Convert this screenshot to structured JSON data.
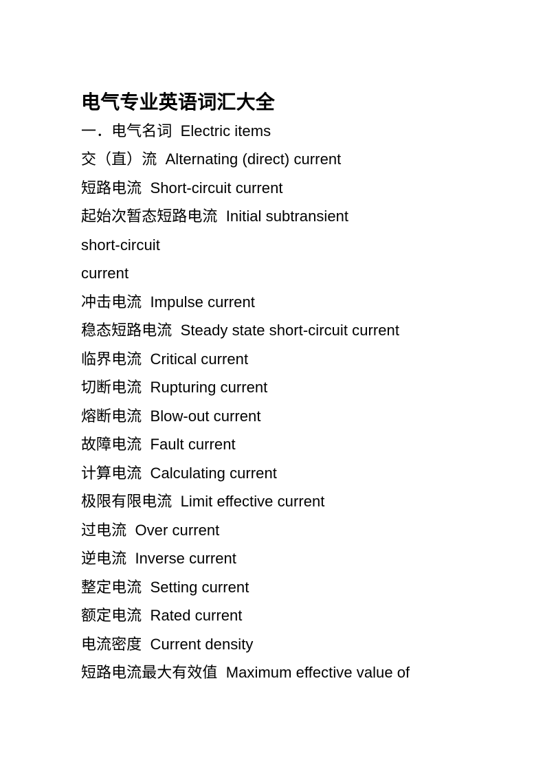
{
  "document": {
    "title": "电气专业英语词汇大全",
    "section_heading": "一．电气名词  Electric items",
    "lines": [
      {
        "text": "一．电气名词  Electric items",
        "kind": "section-heading"
      },
      {
        "text": "交（直）流  Alternating (direct) current",
        "kind": "entry"
      },
      {
        "text": "短路电流  Short-circuit current",
        "kind": "entry"
      },
      {
        "text": "起始次暂态短路电流  Initial subtransient",
        "kind": "entry"
      },
      {
        "text": "short-circuit",
        "kind": "continuation"
      },
      {
        "text": "current",
        "kind": "continuation"
      },
      {
        "text": "冲击电流  Impulse current",
        "kind": "entry"
      },
      {
        "text": "稳态短路电流  Steady state short-circuit current",
        "kind": "entry"
      },
      {
        "text": "临界电流  Critical current",
        "kind": "entry"
      },
      {
        "text": "切断电流  Rupturing current",
        "kind": "entry"
      },
      {
        "text": "熔断电流  Blow-out current",
        "kind": "entry"
      },
      {
        "text": "故障电流  Fault current",
        "kind": "entry"
      },
      {
        "text": "计算电流  Calculating current",
        "kind": "entry"
      },
      {
        "text": "极限有限电流  Limit effective current",
        "kind": "entry"
      },
      {
        "text": "过电流  Over current",
        "kind": "entry"
      },
      {
        "text": "逆电流  Inverse current",
        "kind": "entry"
      },
      {
        "text": "整定电流  Setting current",
        "kind": "entry"
      },
      {
        "text": "额定电流  Rated current",
        "kind": "entry"
      },
      {
        "text": "电流密度  Current density",
        "kind": "entry"
      },
      {
        "text": "短路电流最大有效值  Maximum effective value of",
        "kind": "entry"
      }
    ],
    "colors": {
      "page_background": "#ffffff",
      "text": "#000000"
    }
  }
}
